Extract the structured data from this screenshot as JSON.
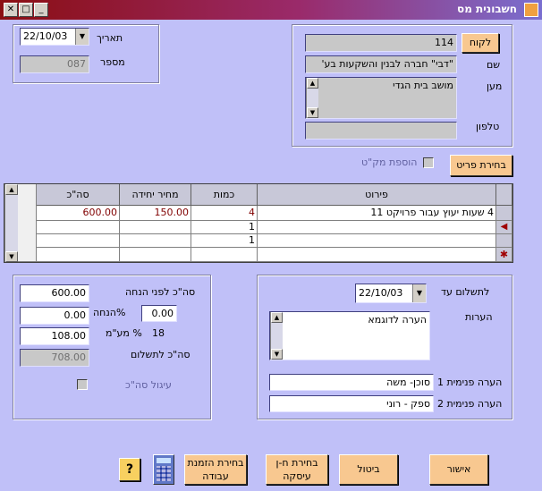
{
  "window": {
    "title": "חשבונית מס",
    "min_glyph": "_",
    "max_glyph": "□",
    "close_glyph": "✕"
  },
  "header": {
    "date_label": "תאריך",
    "date_value": "22/10/03",
    "number_label": "מספר",
    "number_value": "087"
  },
  "customer": {
    "button_label": "לקוח",
    "code_value": "114",
    "name_label": "שם",
    "name_value": "\"דבי\" חברה לבנין והשקעות בע'",
    "address_label": "מען",
    "address_value": "מושב בית הגדי",
    "phone_label": "טלפון",
    "phone_value": ""
  },
  "items_controls": {
    "select_item_label": "בחירת פריט",
    "add_sku_label": "הוספת מק\"ט"
  },
  "grid": {
    "columns": [
      "פירוט",
      "כמות",
      "מחיר יחידה",
      "סה\"כ"
    ],
    "rows": [
      {
        "desc": "4 שעות יעוץ עבור פרויקט 11",
        "qty": "4",
        "price": "150.00",
        "total": "600.00"
      },
      {
        "desc": "",
        "qty": "1",
        "price": "",
        "total": ""
      },
      {
        "desc": "",
        "qty": "1",
        "price": "",
        "total": ""
      },
      {
        "desc": "",
        "qty": "",
        "price": "",
        "total": ""
      }
    ],
    "new_row_marker": "✱",
    "current_row_marker": "◀"
  },
  "payment": {
    "due_label": "לתשלום עד",
    "due_value": "22/10/03",
    "notes_label": "הערות",
    "notes_value": "הערה לדוגמא",
    "internal1_label": "הערה פנימית 1",
    "internal1_value": "סוכן- משה",
    "internal2_label": "הערה פנימית 2",
    "internal2_value": "ספק - רוני"
  },
  "totals": {
    "before_discount_label": "סה\"כ לפני הנחה",
    "before_discount_value": "600.00",
    "discount_label": "הנחה",
    "discount_value": "0.00",
    "discount_pct_value": "0.00",
    "vat_label": "% מע\"מ",
    "vat_value": "108.00",
    "vat_pct_value": "18",
    "to_pay_label": "סה\"כ לתשלום",
    "to_pay_value": "708.00",
    "rounding_label": "עיגול סה\"כ"
  },
  "actions": {
    "ok_label": "אישור",
    "cancel_label": "ביטול",
    "select_account_label": "בחירת ח-ן עיסקה",
    "select_order_label": "בחירת הזמנת עבודה",
    "help_glyph": "?"
  },
  "colors": {
    "background": "#c0c0f8",
    "button": "#f8c890",
    "total_text": "#800000"
  }
}
